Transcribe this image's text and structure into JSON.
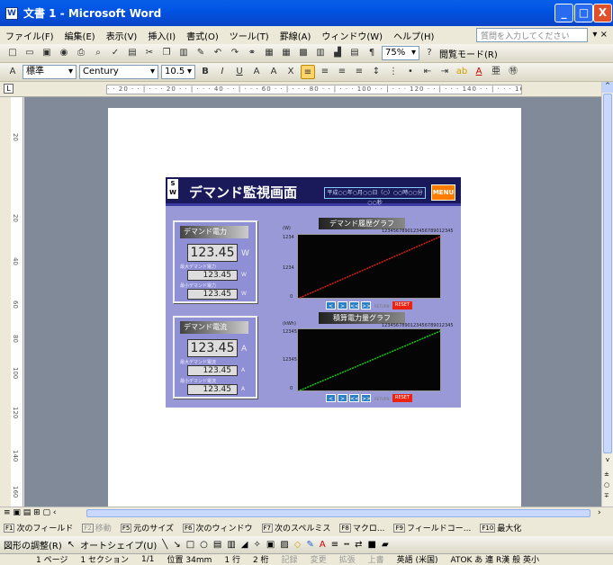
{
  "window": {
    "title": "文書 1 - Microsoft Word",
    "icon": "word-icon",
    "min": "_",
    "max": "□",
    "close": "X"
  },
  "menu": {
    "items": [
      "ファイル(F)",
      "編集(E)",
      "表示(V)",
      "挿入(I)",
      "書式(O)",
      "ツール(T)",
      "罫線(A)",
      "ウィンドウ(W)",
      "ヘルプ(H)"
    ],
    "help_placeholder": "質問を入力してください",
    "close_doc": "▾ ×"
  },
  "toolbar": {
    "zoom": "75%",
    "reading_mode": "閲覧モード(R)"
  },
  "format": {
    "style": "標準",
    "font": "Century",
    "size": "10.5",
    "bold": "B",
    "italic": "I",
    "underline": "U"
  },
  "ruler_text": "· · 20 · · | · · · 20 · · | · · · 40 · · | · · · 60 · · | · · · 80 · · | · · · 100 · · | · · · 120 · · | · · · 140 · · | · · · 160 · · · · |",
  "vruler_marks": [
    "20",
    "20",
    "40",
    "60",
    "80",
    "100",
    "120",
    "140",
    "160"
  ],
  "document": {
    "header_title": "デマンド監視画面",
    "date": "平成○○年○月○○日（○）○○時○○分○○秒",
    "logo": "S\nW",
    "menu_button": "MENU",
    "demand_power": {
      "title": "デマンド電力",
      "value": "123.45",
      "unit": "W",
      "sub1": "最大デマンド電力",
      "val2": "123.45",
      "sub2": "最小デマンド電力",
      "val3": "123.45"
    },
    "demand_current": {
      "title": "デマンド電流",
      "value": "123.45",
      "unit": "A",
      "sub1": "最大デマンド電流",
      "val2": "123.45",
      "sub2": "最小デマンド電流",
      "val3": "123.45"
    },
    "graph1": {
      "title": "デマンド履歴グラフ",
      "unit": "(W)",
      "digits": "1234567890123456789012345",
      "ymax": "1234",
      "ymid": "1234",
      "ymin": "0"
    },
    "graph2": {
      "title": "積算電力量グラフ",
      "unit": "(kWh)",
      "digits": "1234567890123456789012345",
      "ymax": "12345",
      "ymid": "12345",
      "ymin": "0"
    },
    "nav": {
      "prev": "<",
      "next": ">",
      "first": "<<",
      "last": ">>",
      "reset": "RESET",
      "return": "RETURN"
    }
  },
  "fnkeys": [
    {
      "key": "F1",
      "label": "次のフィールド"
    },
    {
      "key": "F2",
      "label": "移動"
    },
    {
      "key": "F5",
      "label": "元のサイズ"
    },
    {
      "key": "F6",
      "label": "次のウィンドウ"
    },
    {
      "key": "F7",
      "label": "次のスペルミス"
    },
    {
      "key": "F8",
      "label": "マクロ..."
    },
    {
      "key": "F9",
      "label": "フィールドコー..."
    },
    {
      "key": "F10",
      "label": "最大化"
    }
  ],
  "drawing": {
    "adjust": "図形の調整(R)",
    "autoshape": "オートシェイプ(U)"
  },
  "status": {
    "page": "1 ページ",
    "section": "1 セクション",
    "pages": "1/1",
    "position": "位置 34mm",
    "line": "1 行",
    "col": "2 桁",
    "rec": "記録",
    "trk": "変更",
    "ext": "拡張",
    "ovr": "上書",
    "lang": "英語 (米国)",
    "ime": "ATOK あ 連 R漢 般 英小"
  }
}
